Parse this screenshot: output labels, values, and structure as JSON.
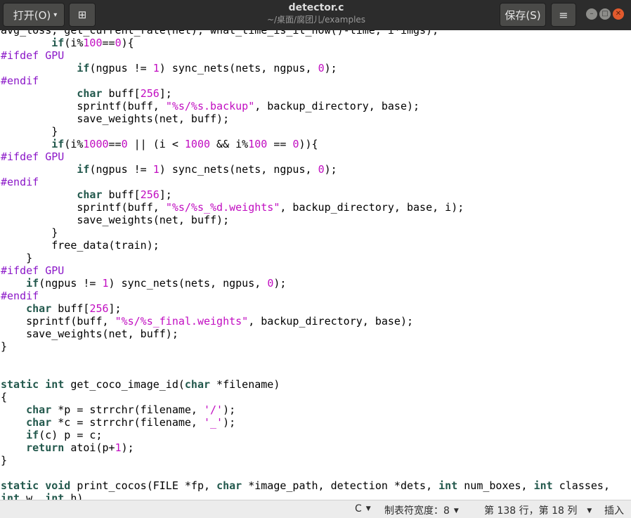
{
  "header": {
    "open_label": "打开(O)",
    "title": "detector.c",
    "subtitle": "~/桌面/腐团儿/examples",
    "save_label": "保存(S)",
    "menu_glyph": "≡",
    "pin_glyph": "⊞",
    "open_arrow": "▾",
    "min_glyph": "–",
    "max_glyph": "□",
    "close_glyph": "✕",
    "icons": [
      "open-dropdown-icon",
      "pin-icon",
      "hamburger-menu-icon",
      "minimize-icon",
      "maximize-icon",
      "close-icon"
    ]
  },
  "code_lines": [
    [
      [
        "avg_loss, get_current_rate(net), what_time_is_it_now()-time, i*imgs);",
        ""
      ]
    ],
    [
      [
        "        ",
        ""
      ],
      [
        "if",
        "kw"
      ],
      [
        "(i%",
        ""
      ],
      [
        "100",
        "nm"
      ],
      [
        "==",
        ""
      ],
      [
        "0",
        "nm"
      ],
      [
        ")",
        ""
      ],
      [
        "{",
        ""
      ]
    ],
    [
      [
        "#ifdef GPU",
        "pp"
      ]
    ],
    [
      [
        "            ",
        ""
      ],
      [
        "if",
        "kw"
      ],
      [
        "(ngpus != ",
        ""
      ],
      [
        "1",
        "nm"
      ],
      [
        ") sync_nets(nets, ngpus, ",
        ""
      ],
      [
        "0",
        "nm"
      ],
      [
        ");",
        ""
      ]
    ],
    [
      [
        "#endif",
        "pp"
      ]
    ],
    [
      [
        "            ",
        ""
      ],
      [
        "char",
        "ty"
      ],
      [
        " buff[",
        ""
      ],
      [
        "256",
        "nm"
      ],
      [
        "];",
        ""
      ]
    ],
    [
      [
        "            sprintf(buff, ",
        ""
      ],
      [
        "\"%s/%s.backup\"",
        "st"
      ],
      [
        ", backup_directory, base);",
        ""
      ]
    ],
    [
      [
        "            save_weights(net, buff);",
        ""
      ]
    ],
    [
      [
        "        }",
        ""
      ]
    ],
    [
      [
        "        ",
        ""
      ],
      [
        "if",
        "kw"
      ],
      [
        "(i%",
        ""
      ],
      [
        "1000",
        "nm"
      ],
      [
        "==",
        ""
      ],
      [
        "0",
        "nm"
      ],
      [
        " || (i < ",
        ""
      ],
      [
        "1000",
        "nm"
      ],
      [
        " && i%",
        ""
      ],
      [
        "100",
        "nm"
      ],
      [
        " == ",
        ""
      ],
      [
        "0",
        "nm"
      ],
      [
        "))",
        ""
      ],
      [
        "{",
        ""
      ]
    ],
    [
      [
        "#ifdef GPU",
        "pp"
      ]
    ],
    [
      [
        "            ",
        ""
      ],
      [
        "if",
        "kw"
      ],
      [
        "(ngpus != ",
        ""
      ],
      [
        "1",
        "nm"
      ],
      [
        ") sync_nets(nets, ngpus, ",
        ""
      ],
      [
        "0",
        "nm"
      ],
      [
        ");",
        ""
      ]
    ],
    [
      [
        "#endif",
        "pp"
      ]
    ],
    [
      [
        "            ",
        ""
      ],
      [
        "char",
        "ty"
      ],
      [
        " buff[",
        ""
      ],
      [
        "256",
        "nm"
      ],
      [
        "];",
        ""
      ]
    ],
    [
      [
        "            sprintf(buff, ",
        ""
      ],
      [
        "\"%s/%s_%d.weights\"",
        "st"
      ],
      [
        ", backup_directory, base, i);",
        ""
      ]
    ],
    [
      [
        "            save_weights(net, buff);",
        ""
      ]
    ],
    [
      [
        "        }",
        ""
      ]
    ],
    [
      [
        "        free_data(train);",
        ""
      ]
    ],
    [
      [
        "    }",
        ""
      ]
    ],
    [
      [
        "#ifdef GPU",
        "pp"
      ]
    ],
    [
      [
        "    ",
        ""
      ],
      [
        "if",
        "kw"
      ],
      [
        "(ngpus != ",
        ""
      ],
      [
        "1",
        "nm"
      ],
      [
        ") sync_nets(nets, ngpus, ",
        ""
      ],
      [
        "0",
        "nm"
      ],
      [
        ");",
        ""
      ]
    ],
    [
      [
        "#endif",
        "pp"
      ]
    ],
    [
      [
        "    ",
        ""
      ],
      [
        "char",
        "ty"
      ],
      [
        " buff[",
        ""
      ],
      [
        "256",
        "nm"
      ],
      [
        "];",
        ""
      ]
    ],
    [
      [
        "    sprintf(buff, ",
        ""
      ],
      [
        "\"%s/%s_final.weights\"",
        "st"
      ],
      [
        ", backup_directory, base);",
        ""
      ]
    ],
    [
      [
        "    save_weights(net, buff);",
        ""
      ]
    ],
    [
      [
        "}",
        ""
      ]
    ],
    [
      [
        "",
        ""
      ]
    ],
    [
      [
        "",
        ""
      ]
    ],
    [
      [
        "static",
        "kw"
      ],
      [
        " ",
        ""
      ],
      [
        "int",
        "ty"
      ],
      [
        " get_coco_image_id(",
        ""
      ],
      [
        "char",
        "ty"
      ],
      [
        " *filename)",
        ""
      ]
    ],
    [
      [
        "{",
        ""
      ]
    ],
    [
      [
        "    ",
        ""
      ],
      [
        "char",
        "ty"
      ],
      [
        " *p = strrchr(filename, ",
        ""
      ],
      [
        "'/'",
        "st"
      ],
      [
        ");",
        ""
      ]
    ],
    [
      [
        "    ",
        ""
      ],
      [
        "char",
        "ty"
      ],
      [
        " *c = strrchr(filename, ",
        ""
      ],
      [
        "'_'",
        "st"
      ],
      [
        ");",
        ""
      ]
    ],
    [
      [
        "    ",
        ""
      ],
      [
        "if",
        "kw"
      ],
      [
        "(c) p = c;",
        ""
      ]
    ],
    [
      [
        "    ",
        ""
      ],
      [
        "return",
        "kw"
      ],
      [
        " atoi(p+",
        ""
      ],
      [
        "1",
        "nm"
      ],
      [
        ");",
        ""
      ]
    ],
    [
      [
        "}",
        ""
      ]
    ],
    [
      [
        "",
        ""
      ]
    ],
    [
      [
        "static",
        "kw"
      ],
      [
        " ",
        ""
      ],
      [
        "void",
        "ty"
      ],
      [
        " print_cocos(FILE *fp, ",
        ""
      ],
      [
        "char",
        "ty"
      ],
      [
        " *image_path, detection *dets, ",
        ""
      ],
      [
        "int",
        "ty"
      ],
      [
        " num_boxes, ",
        ""
      ],
      [
        "int",
        "ty"
      ],
      [
        " classes,",
        ""
      ]
    ],
    [
      [
        "int",
        "ty"
      ],
      [
        " w, ",
        ""
      ],
      [
        "int",
        "ty"
      ],
      [
        " h)",
        ""
      ]
    ]
  ],
  "status": {
    "language": "C",
    "tab_width": "制表符宽度：8",
    "position": "第 138 行，第 18 列",
    "mode": "插入",
    "dropdown_glyph": "▼"
  }
}
